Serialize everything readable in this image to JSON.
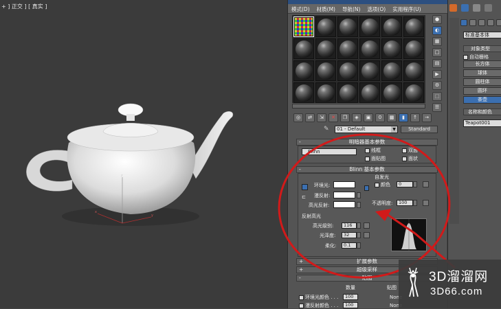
{
  "viewport": {
    "label": "+ ] 正交 ] [ 真实 ]",
    "axis_z": "z",
    "axis_x": "x",
    "axis_y": "y"
  },
  "material_editor": {
    "menu": [
      "模式(D)",
      "材质(M)",
      "导航(N)",
      "选项(O)",
      "实用程序(U)"
    ],
    "material_name": "01 - Default",
    "type_button": "Standard",
    "rollout_shader": "明暗器基本参数",
    "shader": "Blinn",
    "shader_checks": [
      "线框",
      "双面",
      "面贴图",
      "面状"
    ],
    "rollout_blinn": "Blinn 基本参数",
    "ambient_label": "环境光:",
    "diffuse_label": "漫反射:",
    "specular_label": "高光反射:",
    "self_illum_label": "自发光",
    "color_label": "颜色",
    "self_illum_value": "0",
    "opacity_label": "不透明度:",
    "opacity_value": "100",
    "spec_group": "反射高光",
    "spec_level_label": "高光级别:",
    "spec_level_value": "116",
    "gloss_label": "光泽度:",
    "gloss_value": "32",
    "soften_label": "柔化:",
    "soften_value": "0.1",
    "rollout_ext": "扩展参数",
    "rollout_super": "超级采样",
    "rollout_maps": "贴图",
    "maps_amount_header": "数量",
    "maps_map_header": "贴图",
    "map_rows": [
      {
        "name": "环境光颜色 . . .",
        "amount": "100",
        "map": "None"
      },
      {
        "name": "漫反射颜色 . . .",
        "amount": "100",
        "map": "None"
      }
    ]
  },
  "command_panel": {
    "category": "标准基本体",
    "rollout_type": "对象类型",
    "autogrid": "自动栅格",
    "objects": [
      "长方体",
      "球体",
      "圆柱体",
      "圆环",
      "茶壶"
    ],
    "rollout_name": "名称和颜色",
    "object_name": "Teapot001"
  },
  "watermark": {
    "line1": "3D溜溜网",
    "line2": "3D66.com"
  },
  "colors": {
    "annotation": "#d11a1a",
    "accent": "#3b6fb0"
  }
}
